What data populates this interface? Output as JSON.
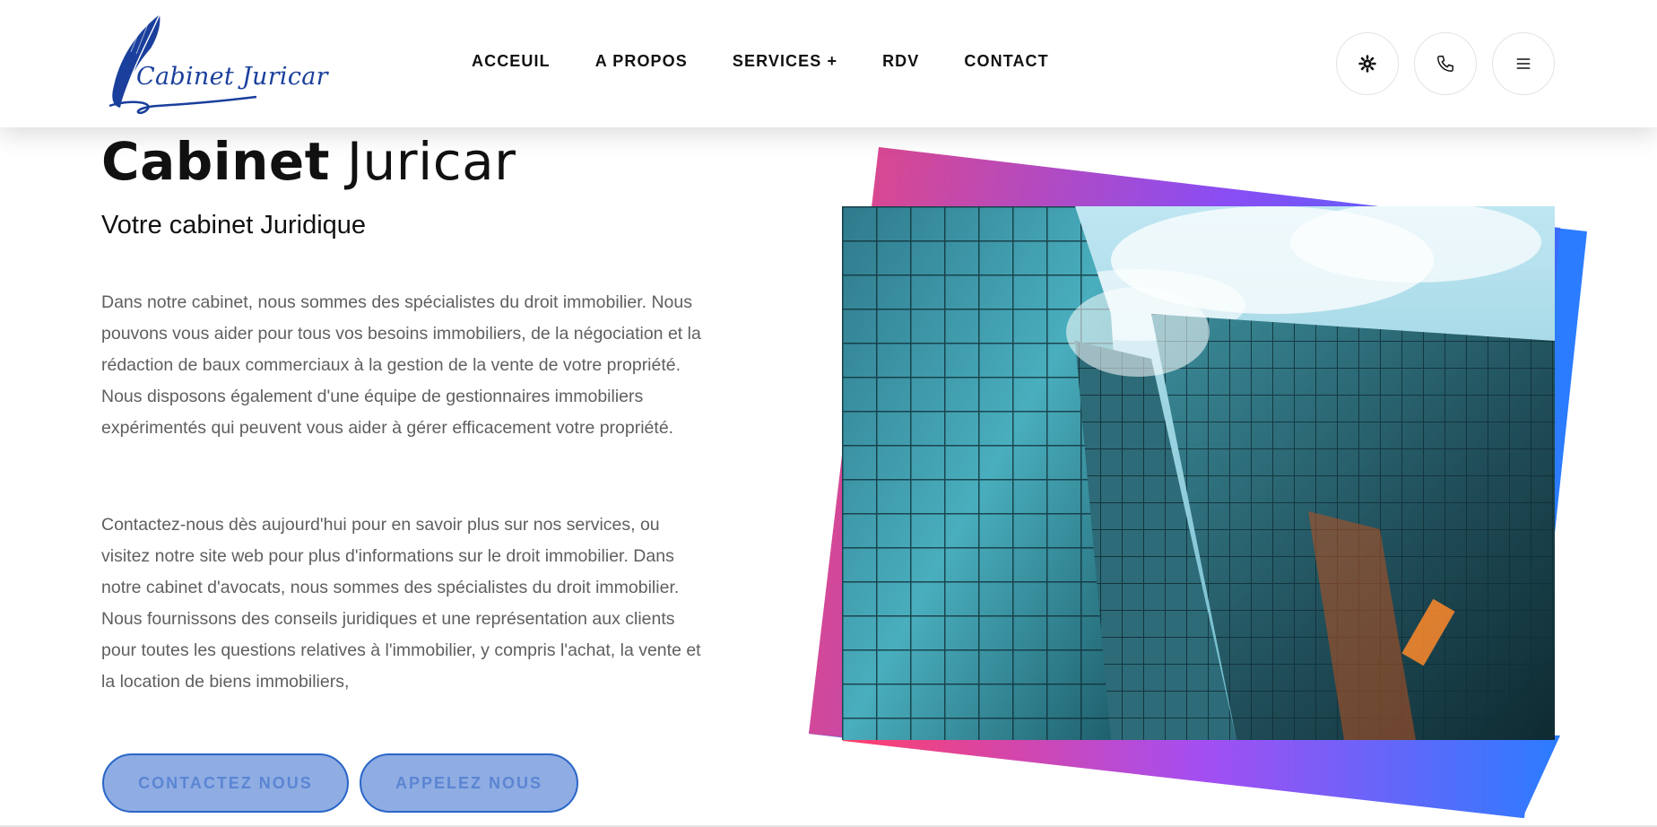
{
  "logo": {
    "text": "Cabinet Juricar",
    "alt": "Cabinet Juricar logo"
  },
  "nav": {
    "items": [
      {
        "label": "ACCEUIL"
      },
      {
        "label": "A PROPOS"
      },
      {
        "label": "SERVICES +"
      },
      {
        "label": "RDV"
      },
      {
        "label": "CONTACT"
      }
    ]
  },
  "header_icons": [
    {
      "name": "settings-icon"
    },
    {
      "name": "phone-icon"
    },
    {
      "name": "menu-icon"
    }
  ],
  "hero": {
    "title_bold": "Cabinet",
    "title_light": "Juricar",
    "subtitle": "Votre cabinet Juridique",
    "paragraph1": "Dans notre cabinet, nous sommes des spécialistes du droit immobilier. Nous pouvons vous aider pour tous vos besoins immobiliers, de la négociation et la rédaction de baux commerciaux à la gestion de la vente de votre propriété. Nous disposons également d'une équipe de gestionnaires immobiliers expérimentés qui peuvent vous aider à gérer efficacement votre propriété.",
    "paragraph2": "Contactez-nous dès aujourd'hui pour en savoir plus sur nos services, ou visitez notre site web pour plus d'informations sur le droit immobilier. Dans notre cabinet d'avocats, nous sommes des spécialistes du droit immobilier. Nous fournissons des conseils juridiques et une représentation aux clients pour toutes les questions relatives à l'immobilier, y compris l'achat, la vente et la location de biens immobiliers,",
    "contact_button": "CONTACTEZ NOUS",
    "call_button": "APPELEZ NOUS"
  },
  "colors": {
    "accent_pink": "#e8477e",
    "accent_purple": "#8a4df3",
    "accent_blue": "#2b7cff",
    "button_fill": "#8fade3",
    "button_border": "#2a66c7",
    "button_text": "#5b85d3",
    "paragraph_text": "#5f5f5f"
  },
  "image": {
    "name": "glass-skyscraper-photo"
  }
}
